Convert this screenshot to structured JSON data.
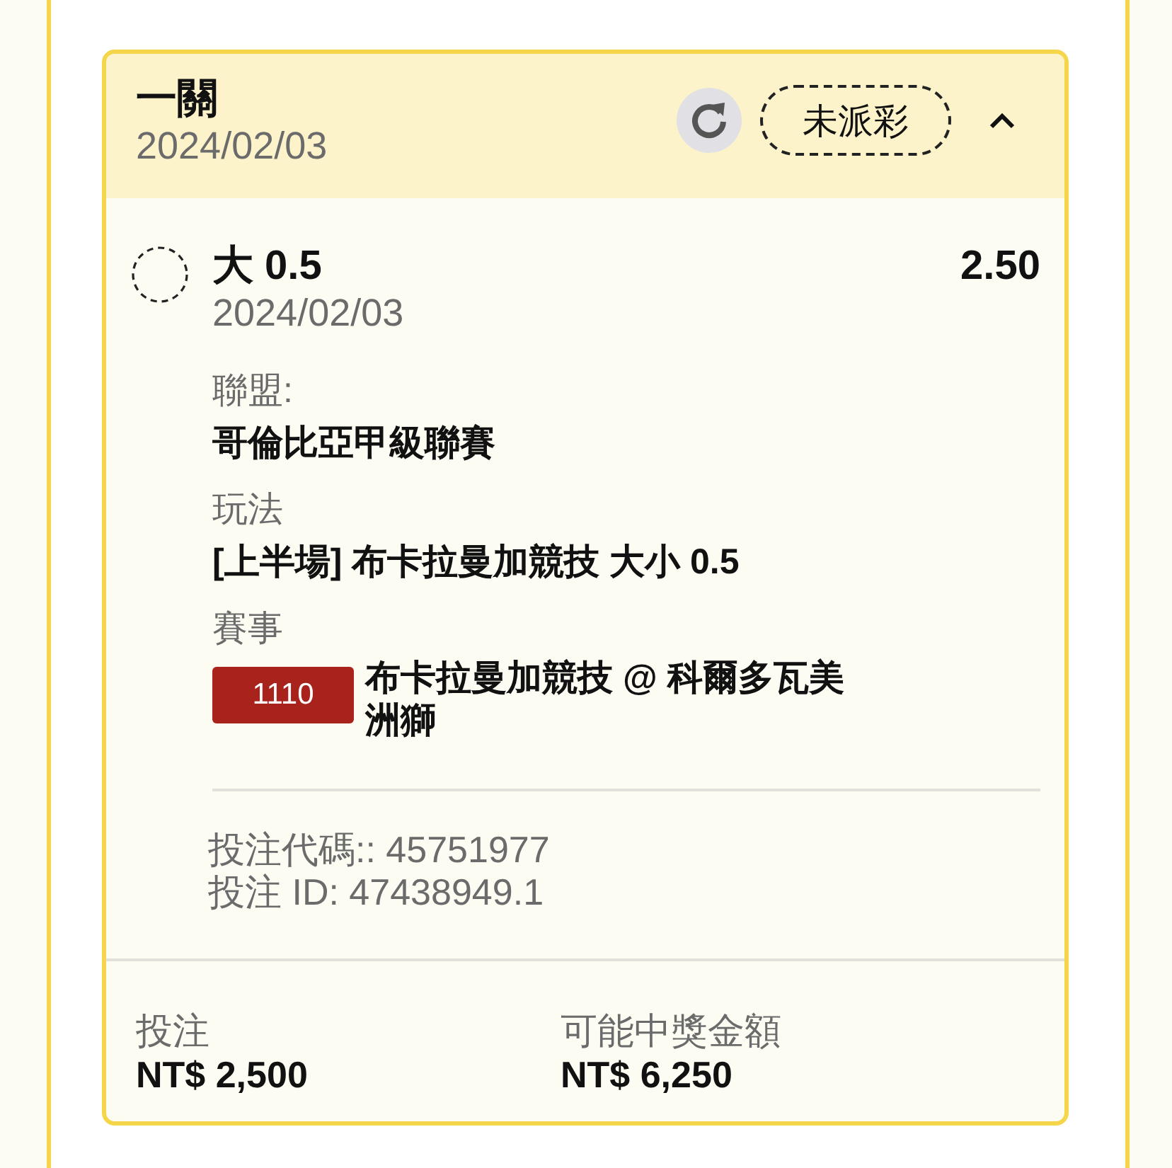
{
  "bet_card": {
    "title": "一關",
    "date": "2024/02/03",
    "status": "未派彩",
    "expanded": true
  },
  "selections": [
    {
      "settled": false,
      "name": "大 0.5",
      "odds": "2.50",
      "date": "2024/02/03",
      "details": [
        {
          "kind": "text",
          "label": "聯盟:",
          "value": "哥倫比亞甲級聯賽"
        },
        {
          "kind": "text",
          "label": "玩法",
          "value": "[上半場] 布卡拉曼加競技 大小 0.5"
        },
        {
          "kind": "event",
          "label": "賽事",
          "event_code": "1110",
          "value": "布卡拉曼加競技 @ 科爾多瓦美洲獅"
        }
      ]
    }
  ],
  "bet_codes": [
    "投注代碼:: 45751977",
    "投注 ID: 47438949.1"
  ],
  "summary": [
    {
      "label": "投注",
      "value": "NT$ 2,500"
    },
    {
      "label": "可能中獎金額",
      "value": "NT$ 6,250"
    }
  ]
}
